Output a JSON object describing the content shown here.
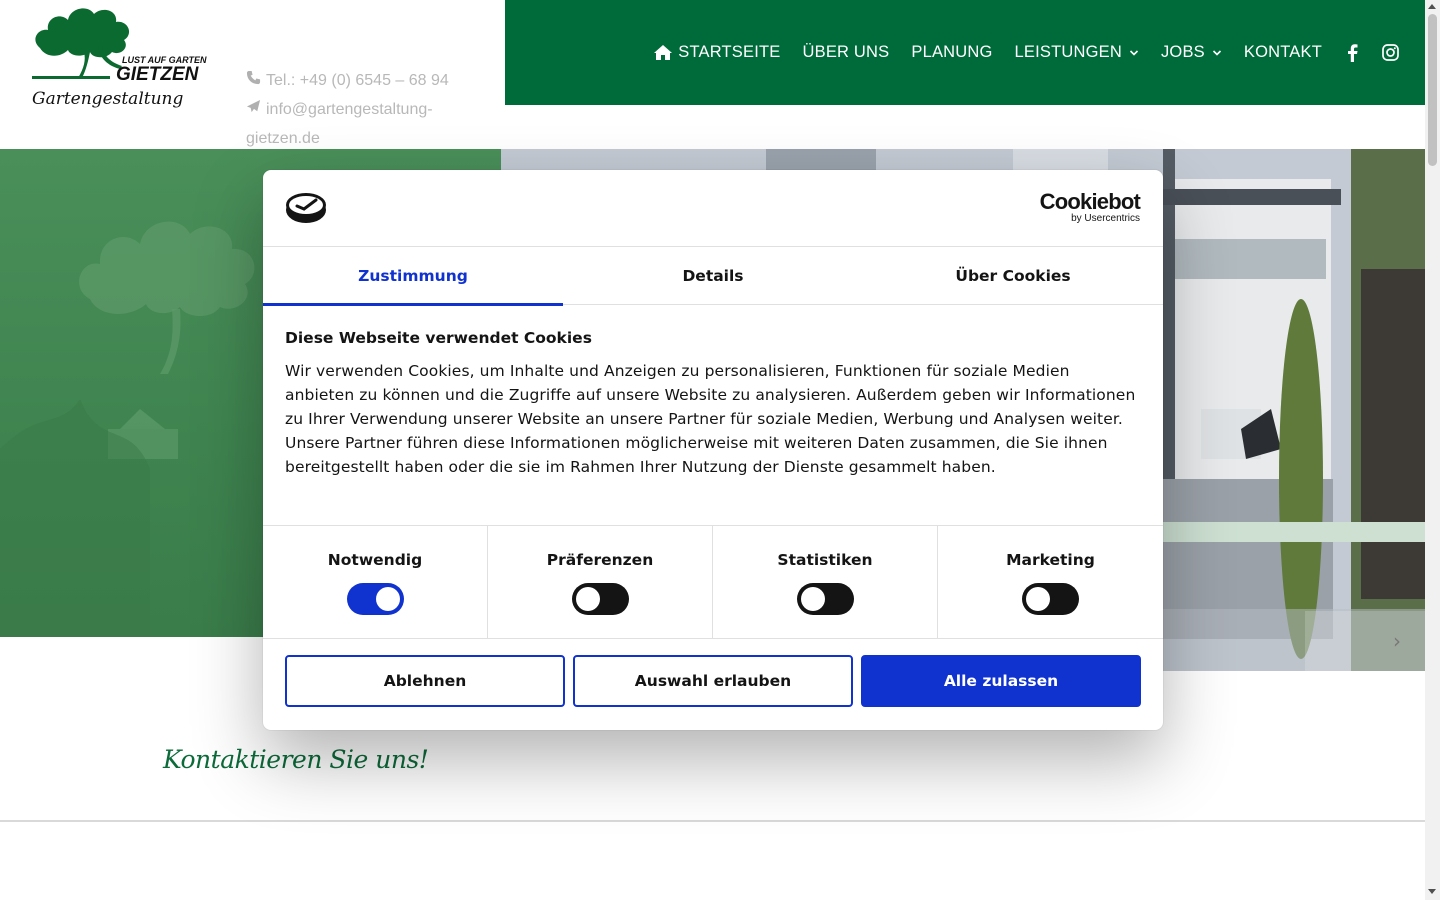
{
  "header": {
    "logo": {
      "tagline": "LUST AUF GARTEN",
      "name": "GIETZEN",
      "subtitle": "Gartengestaltung"
    },
    "contact": {
      "phone": "Tel.: +49 (0) 6545 – 68 94",
      "email_line1": "info@gartengestaltung-",
      "email_line2": "gietzen.de"
    },
    "nav": {
      "items": [
        {
          "label": "STARTSEITE",
          "icon": "home-icon"
        },
        {
          "label": "ÜBER UNS"
        },
        {
          "label": "PLANUNG"
        },
        {
          "label": "LEISTUNGEN",
          "dropdown": true
        },
        {
          "label": "JOBS",
          "dropdown": true
        },
        {
          "label": "KONTAKT"
        }
      ],
      "social": [
        "facebook-icon",
        "instagram-icon"
      ]
    },
    "colors": {
      "nav_bg": "#006b3a",
      "brand_green": "#0c6b3a"
    }
  },
  "main": {
    "contact_heading": "Kontaktieren Sie uns!"
  },
  "cookie_dialog": {
    "brand": {
      "name": "Cookiebot",
      "by": "by Usercentrics"
    },
    "tabs": [
      {
        "label": "Zustimmung",
        "active": true
      },
      {
        "label": "Details",
        "active": false
      },
      {
        "label": "Über Cookies",
        "active": false
      }
    ],
    "title": "Diese Webseite verwendet Cookies",
    "text": "Wir verwenden Cookies, um Inhalte und Anzeigen zu personalisieren, Funktionen für soziale Medien anbieten zu können und die Zugriffe auf unsere Website zu analysieren. Außerdem geben wir Informationen zu Ihrer Verwendung unserer Website an unsere Partner für soziale Medien, Werbung und Analysen weiter. Unsere Partner führen diese Informationen möglicherweise mit weiteren Daten zusammen, die Sie ihnen bereitgestellt haben oder die sie im Rahmen Ihrer Nutzung der Dienste gesammelt haben.",
    "toggles": [
      {
        "label": "Notwendig",
        "on": true
      },
      {
        "label": "Präferenzen",
        "on": false
      },
      {
        "label": "Statistiken",
        "on": false
      },
      {
        "label": "Marketing",
        "on": false
      }
    ],
    "buttons": {
      "decline": "Ablehnen",
      "allow_selection": "Auswahl erlauben",
      "allow_all": "Alle zulassen"
    },
    "colors": {
      "accent": "#1032cf",
      "text": "#141414"
    }
  }
}
